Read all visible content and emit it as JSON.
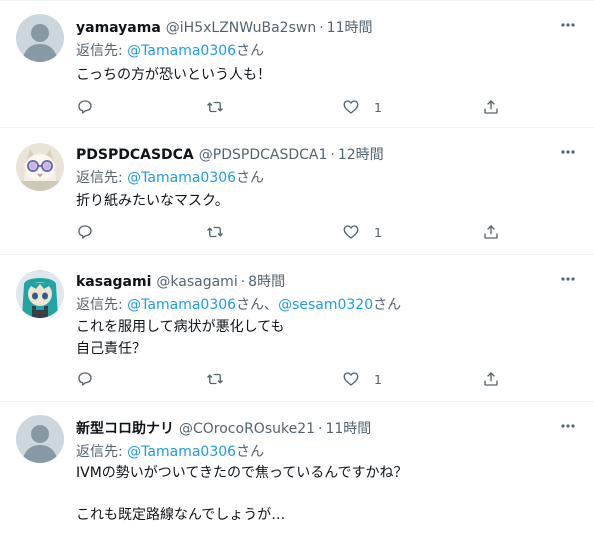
{
  "tweets": [
    {
      "name": "yamayama",
      "handle": "@iH5xLZNWuBa2swn",
      "dot": "·",
      "time": "11時間",
      "reply_prefix": "返信先: ",
      "reply_to": "@Tamama0306",
      "reply_suffix": "さん",
      "body": [
        "こっちの方が恐いという人も！"
      ],
      "like_count": "1"
    },
    {
      "name": "PDSPDCASDCA",
      "handle": "@PDSPDCASDCA1",
      "dot": "·",
      "time": "12時間",
      "reply_prefix": "返信先: ",
      "reply_to": "@Tamama0306",
      "reply_suffix": "さん",
      "body": [
        "折り紙みたいなマスク。"
      ],
      "like_count": "1"
    },
    {
      "name": "kasagami",
      "handle": "@kasagami",
      "dot": "·",
      "time": "8時間",
      "reply_prefix": "返信先: ",
      "reply_to": "@Tamama0306",
      "reply_mid": "さん、",
      "reply_to2": "@sesam0320",
      "reply_suffix": "さん",
      "body": [
        "これを服用して病状が悪化しても",
        "自己責任？"
      ],
      "like_count": "1"
    },
    {
      "name": "新型コロ助ナリ",
      "handle": "@COrocoROsuke21",
      "dot": "·",
      "time": "11時間",
      "reply_prefix": "返信先: ",
      "reply_to": "@Tamama0306",
      "reply_suffix": "さん",
      "body": [
        "IVMの勢いがついてきたので焦っているんですかね？",
        "",
        "これも既定路線なんでしょうが…"
      ]
    }
  ],
  "icons": {
    "more": "more-dots-icon",
    "reply": "reply-icon",
    "retweet": "retweet-icon",
    "like": "heart-icon",
    "share": "share-icon"
  },
  "colors": {
    "link": "#1d9bf0",
    "secondary_text": "#536471",
    "divider": "#eff3f4"
  }
}
